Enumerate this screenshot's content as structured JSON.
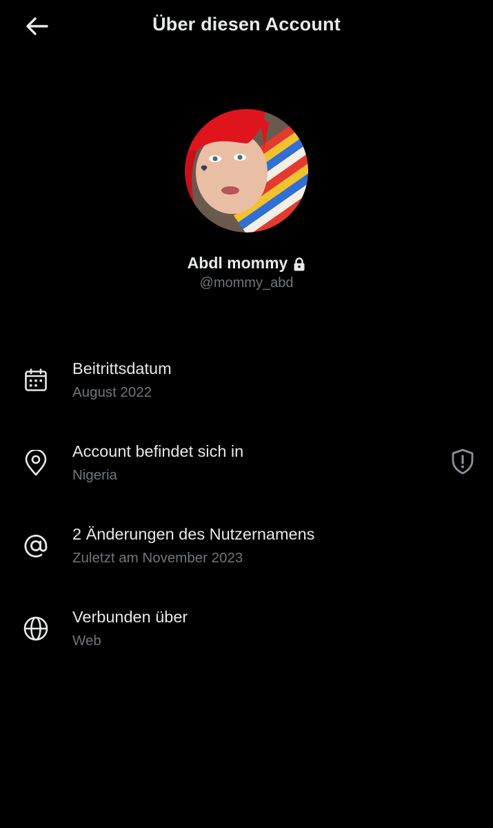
{
  "header": {
    "title": "Über diesen Account",
    "back_icon": "arrow-left-icon"
  },
  "profile": {
    "display_name": "Abdl mommy",
    "handle": "@mommy_abd",
    "protected_icon": "lock-icon"
  },
  "info_items": [
    {
      "icon": "calendar-icon",
      "title": "Beitrittsdatum",
      "subtitle": "August 2022"
    },
    {
      "icon": "location-pin-icon",
      "title": "Account befindet sich in",
      "subtitle": "Nigeria",
      "trailing_icon": "shield-alert-icon"
    },
    {
      "icon": "at-sign-icon",
      "title": "2 Änderungen des Nutzernamens",
      "subtitle": "Zuletzt am November 2023"
    },
    {
      "icon": "globe-icon",
      "title": "Verbunden über",
      "subtitle": "Web"
    }
  ],
  "colors": {
    "background": "#000000",
    "primary_text": "#e7e9ea",
    "secondary_text": "#71767b"
  }
}
